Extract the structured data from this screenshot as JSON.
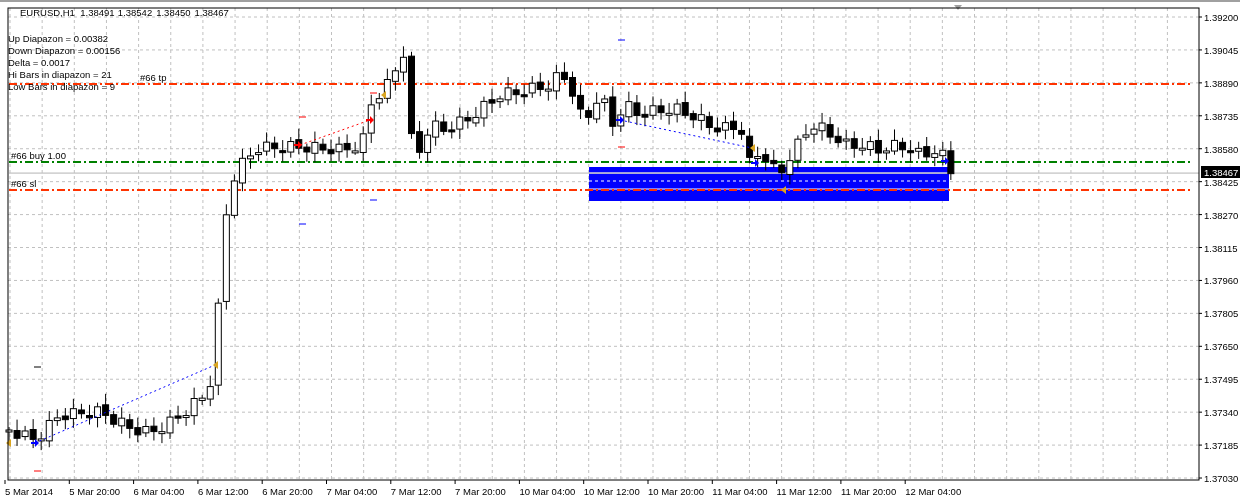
{
  "header": {
    "symbol": "EURUSD,H1",
    "quotes": [
      "1.38491",
      "1.38542",
      "1.38450",
      "1.38467"
    ]
  },
  "info_lines": [
    "Up Diapazon = 0.00382",
    "Down Diapazon = 0.00156",
    "Delta = 0.0017",
    "Hi Bars in diapazon = 21",
    "Low Bars in diapazon = 9"
  ],
  "order_lines": [
    {
      "label": "#66 tp",
      "color": "#ff3300"
    },
    {
      "label": "#66 buy 1.00",
      "color": "#008000"
    },
    {
      "label": "#66 sl",
      "color": "#ff3300"
    }
  ],
  "price_axis": [
    "1.39200",
    "1.39045",
    "1.38890",
    "1.38735",
    "1.38580",
    "1.38425",
    "1.38270",
    "1.38115",
    "1.37960",
    "1.37805",
    "1.37650",
    "1.37495",
    "1.37340",
    "1.37185",
    "1.37030"
  ],
  "current_price": "1.38467",
  "time_axis": [
    "5 Mar 2014",
    "5 Mar 20:00",
    "6 Mar 04:00",
    "6 Mar 12:00",
    "6 Mar 20:00",
    "7 Mar 04:00",
    "7 Mar 12:00",
    "7 Mar 20:00",
    "10 Mar 04:00",
    "10 Mar 12:00",
    "10 Mar 20:00",
    "11 Mar 04:00",
    "11 Mar 12:00",
    "11 Mar 20:00",
    "12 Mar 04:00"
  ]
}
